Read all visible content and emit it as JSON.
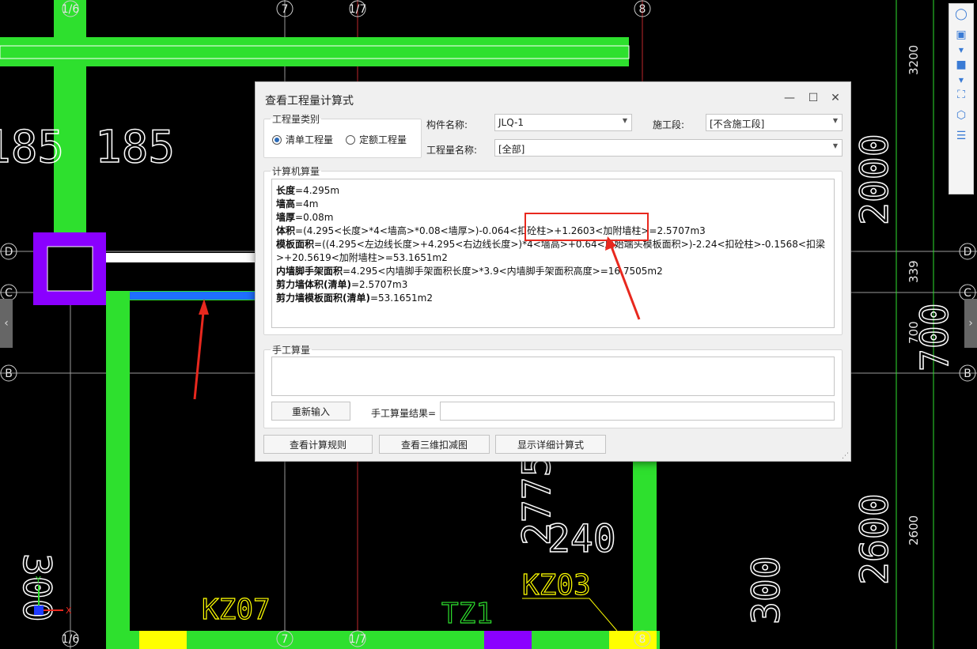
{
  "cad": {
    "axis_labels": [
      "1/6",
      "7",
      "1/7",
      "8",
      "D",
      "C",
      "B",
      "D",
      "C",
      "B",
      "1/6",
      "7",
      "1/7",
      "8"
    ],
    "dims": [
      "185",
      "185",
      "3200",
      "2000",
      "339",
      "700",
      "700",
      "2600",
      "2600",
      "240",
      "2775",
      "300",
      "300"
    ],
    "tags": [
      "KZ07",
      "TZ1",
      "KZ03"
    ],
    "colors": {
      "green": "#2ee02e",
      "purple": "#8a00ff",
      "blue": "#1f6fff",
      "yellow": "#ffff00",
      "red_arrow": "#e8281e"
    }
  },
  "dialog": {
    "title": "查看工程量计算式",
    "category_legend": "工程量类别",
    "radio_list": "清单工程量",
    "radio_quota": "定额工程量",
    "component_label": "构件名称:",
    "component_value": "JLQ-1",
    "stage_label": "施工段:",
    "stage_value": "[不含施工段]",
    "qty_name_label": "工程量名称:",
    "qty_name_value": "[全部]",
    "computer_legend": "计算机算量",
    "lines": [
      {
        "k": "长度",
        "v": "=4.295m"
      },
      {
        "k": "墙高",
        "v": "=4m"
      },
      {
        "k": "墙厚",
        "v": "=0.08m"
      },
      {
        "k": "体积",
        "v": "=(4.295<长度>*4<墙高>*0.08<墙厚>)-0.064<扣砼柱>+1.2603<加附墙柱>=2.5707m3"
      },
      {
        "k": "模板面积",
        "v": "=((4.295<左边线长度>+4.295<右边线长度>)*4<墙高>+0.64<原始端头模板面积>)-2.24<扣砼柱>-0.1568<扣梁>+20.5619<加附墙柱>=53.1651m2"
      },
      {
        "k": "内墙脚手架面积",
        "v": "=4.295<内墙脚手架面积长度>*3.9<内墙脚手架面积高度>=16.7505m2"
      },
      {
        "k": "剪力墙体积(清单)",
        "v": "=2.5707m3"
      },
      {
        "k": "剪力墙模板面积(清单)",
        "v": "=53.1651m2"
      }
    ],
    "manual_legend": "手工算量",
    "reinput_button": "重新输入",
    "manual_result_label": "手工算量结果=",
    "btn_rules": "查看计算规则",
    "btn_3d": "查看三维扣减图",
    "btn_detail": "显示详细计算式"
  }
}
